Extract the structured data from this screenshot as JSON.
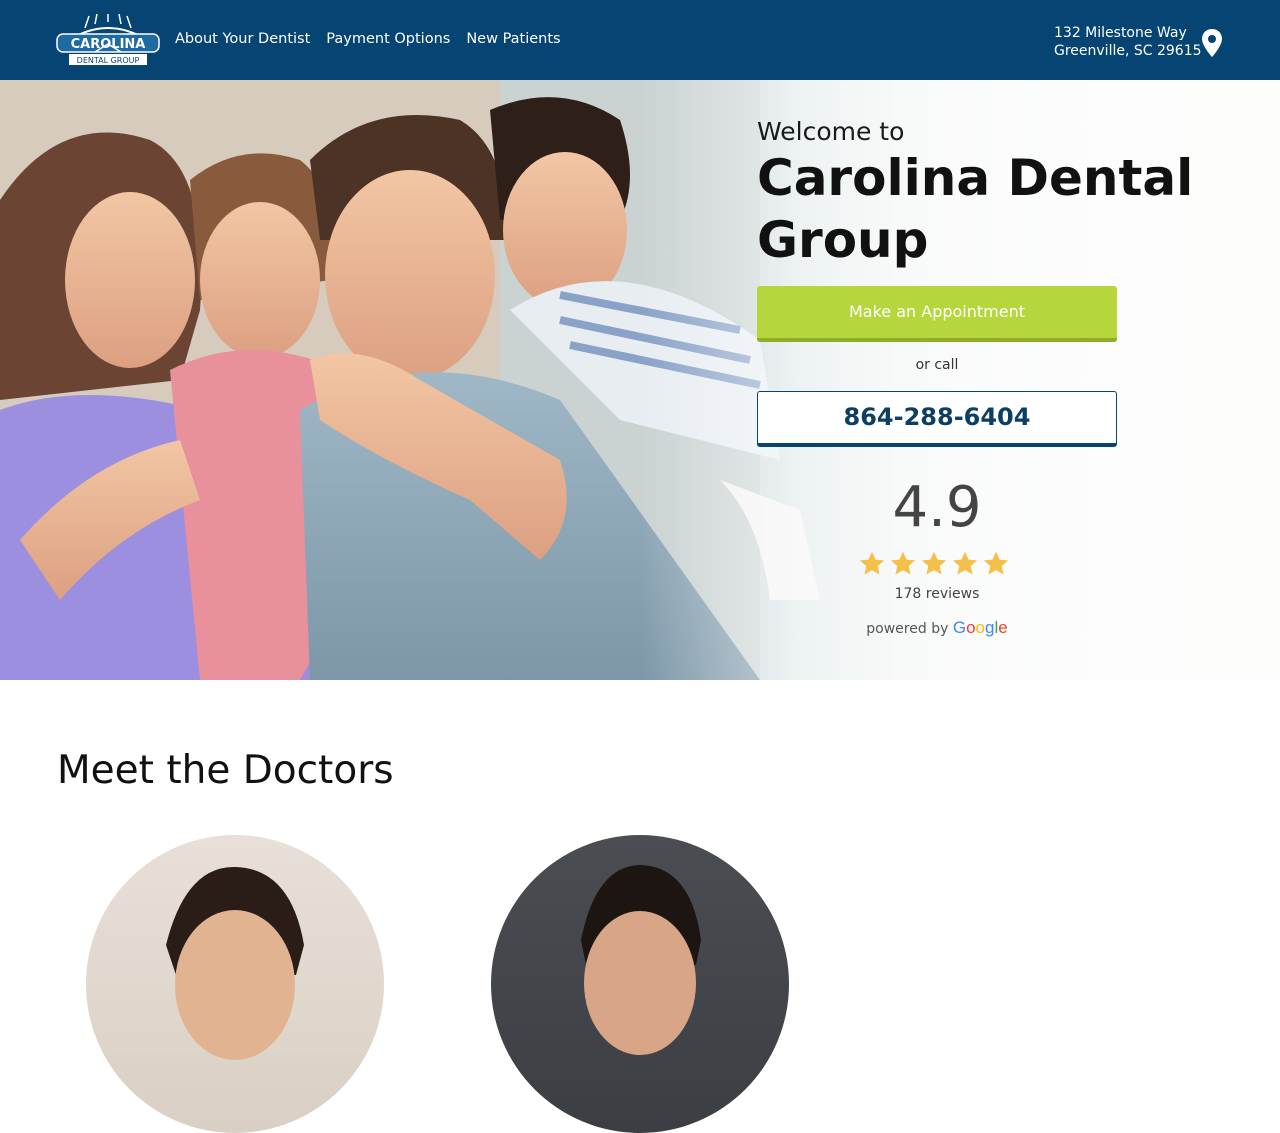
{
  "header": {
    "logo_text": "CAROLINA",
    "logo_subtext": "DENTAL GROUP",
    "nav": [
      "About Your Dentist",
      "Payment Options",
      "New Patients"
    ],
    "address_line1": "132 Milestone Way",
    "address_line2": "Greenville, SC 29615",
    "location_icon": "map-pin-icon"
  },
  "hero": {
    "welcome": "Welcome to",
    "brand": "Carolina Dental Group",
    "appointment_label": "Make an Appointment",
    "or_call": "or call",
    "phone": "864-288-6404",
    "rating": "4.9",
    "stars": 5,
    "reviews": "178 reviews",
    "powered_by": "powered by",
    "google": "Google"
  },
  "doctors": {
    "title": "Meet the Doctors"
  },
  "colors": {
    "header_bg": "#064473",
    "appointment_green": "#b5d63d",
    "phone_text": "#0c3f63",
    "star": "#f5c04a"
  }
}
